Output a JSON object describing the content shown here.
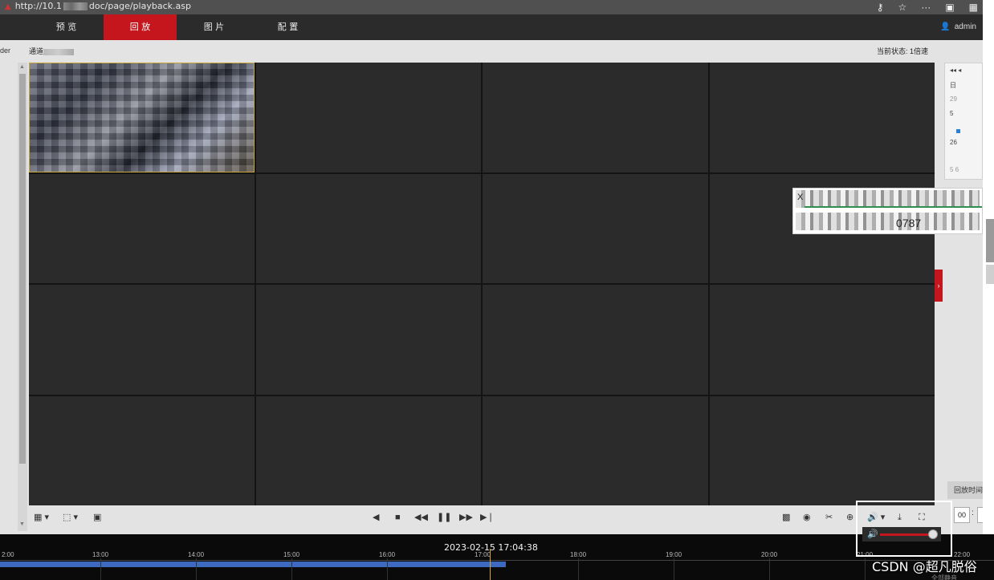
{
  "browser": {
    "url_prefix": "http://10.1",
    "url_suffix": "doc/page/playback.asp"
  },
  "nav": {
    "tabs": [
      {
        "label": "预 览"
      },
      {
        "label": "回 放"
      },
      {
        "label": "图 片"
      },
      {
        "label": "配 置"
      }
    ],
    "active_index": 1,
    "user": "admin"
  },
  "header": {
    "left_cut": "der",
    "channel_prefix": "通道",
    "status": "当前状态: 1倍速"
  },
  "calendar": {
    "row1": "◂◂  ◂",
    "row2": "日",
    "row3": "29",
    "row4": "5",
    "row5": "26",
    "row6": "5   6"
  },
  "popup": {
    "letter": "X",
    "text": "0787"
  },
  "panel": {
    "playback_time_tab": "回放时间",
    "hour": "00",
    "colon": ":"
  },
  "timeline": {
    "datetime": "2023-02-15 17:04:38",
    "ticks": [
      "2:00",
      "13:00",
      "14:00",
      "15:00",
      "16:00",
      "17:00",
      "18:00",
      "19:00",
      "20:00",
      "21:00",
      "22:00"
    ],
    "recorded_until_fraction": 0.509
  },
  "watermark": "CSDN @超凡脱俗",
  "bottom_text": "全部静音",
  "colors": {
    "accent": "#c4161c",
    "nav_bg": "#2b2b2b",
    "cell_bg": "#2b2b2b",
    "timeline_bar": "#3d69c0",
    "cursor": "#d9a524"
  }
}
